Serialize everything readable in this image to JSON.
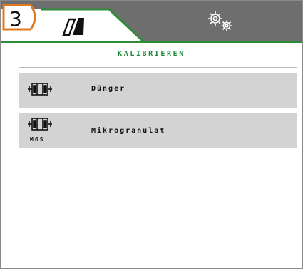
{
  "header": {
    "step_badge": "3",
    "tabs": [
      {
        "icon": "seed-drill-icon",
        "active": true
      },
      {
        "icon": "gears-icon",
        "active": false
      }
    ]
  },
  "section": {
    "title": "KALIBRIEREN"
  },
  "items": [
    {
      "label": "Dünger",
      "icon": "metering-unit-icon",
      "sublabel": ""
    },
    {
      "label": "Mikrogranulat",
      "icon": "metering-unit-icon",
      "sublabel": "MGS"
    }
  ],
  "colors": {
    "accent_green": "#2e8b3a",
    "tab_inactive": "#6e6e6e",
    "badge_orange": "#e07a1f",
    "row_bg": "#d3d3d3"
  }
}
